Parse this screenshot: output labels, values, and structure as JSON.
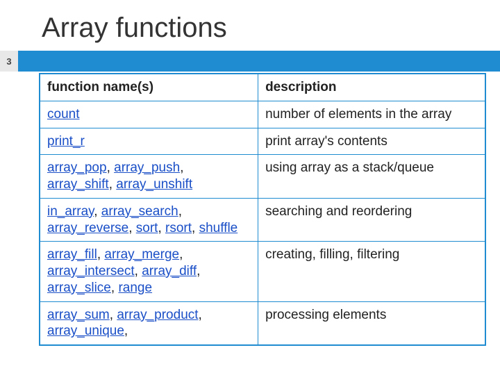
{
  "slide": {
    "title": "Array functions",
    "page_number": "3"
  },
  "table": {
    "headers": {
      "col1": "function name(s)",
      "col2": "description"
    },
    "rows": [
      {
        "functions": [
          "count"
        ],
        "description": "number of elements in the array"
      },
      {
        "functions": [
          "print_r"
        ],
        "description": "print array's contents"
      },
      {
        "functions": [
          "array_pop",
          "array_push",
          "array_shift",
          "array_unshift"
        ],
        "description": "using array as a stack/queue"
      },
      {
        "functions": [
          "in_array",
          "array_search",
          "array_reverse",
          "sort",
          "rsort",
          "shuffle"
        ],
        "description": "searching and reordering"
      },
      {
        "functions": [
          "array_fill",
          "array_merge",
          "array_intersect",
          "array_diff",
          "array_slice",
          "range"
        ],
        "description": "creating, filling, filtering"
      },
      {
        "functions": [
          "array_sum",
          "array_product",
          "array_unique"
        ],
        "trailing": ",",
        "description": "processing elements"
      }
    ]
  }
}
